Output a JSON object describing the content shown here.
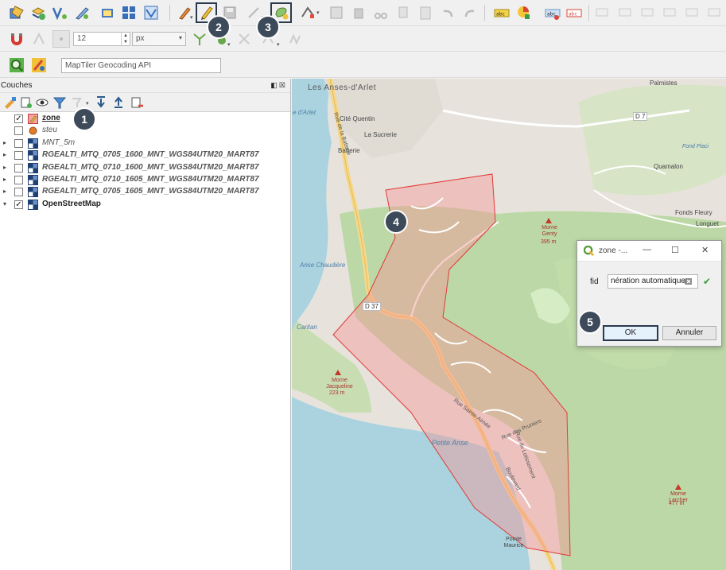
{
  "toolbar": {
    "size_value": "12",
    "unit_value": "px"
  },
  "locator": {
    "placeholder": "MapTiler Geocoding API"
  },
  "layers_panel": {
    "title": "Couches",
    "layers": [
      {
        "name": "zone",
        "checked": true,
        "style": "bold-underline",
        "icon": "polygon-edit-icon",
        "expand": ""
      },
      {
        "name": "steu",
        "checked": false,
        "style": "italic",
        "icon": "point-icon",
        "expand": ""
      },
      {
        "name": "MNT_5m",
        "checked": false,
        "style": "italic",
        "icon": "raster-icon",
        "expand": "▸"
      },
      {
        "name": "RGEALTI_MTQ_0705_1600_MNT_WGS84UTM20_MART87",
        "checked": false,
        "style": "bold-italic",
        "icon": "raster-icon",
        "expand": "▸"
      },
      {
        "name": "RGEALTI_MTQ_0710_1600_MNT_WGS84UTM20_MART87",
        "checked": false,
        "style": "bold-italic",
        "icon": "raster-icon",
        "expand": "▸"
      },
      {
        "name": "RGEALTI_MTQ_0710_1605_MNT_WGS84UTM20_MART87",
        "checked": false,
        "style": "bold-italic",
        "icon": "raster-icon",
        "expand": "▸"
      },
      {
        "name": "RGEALTI_MTQ_0705_1605_MNT_WGS84UTM20_MART87",
        "checked": false,
        "style": "bold-italic",
        "icon": "raster-icon",
        "expand": "▸"
      },
      {
        "name": "OpenStreetMap",
        "checked": true,
        "style": "bold",
        "icon": "raster-icon",
        "expand": "▾"
      }
    ]
  },
  "map": {
    "labels": {
      "town": "Les Anses-d'Arlet",
      "arlet": "e d'Arlet",
      "cite_quentin": "Cité Quentin",
      "la_sucrerie": "La Sucrerie",
      "batterie": "Batterie",
      "rue_batterie": "Rue de la Batterie",
      "palmistes": "Palmistes",
      "d7": "D 7",
      "fond_placide": "Fond Placi",
      "quamalon": "Quamalon",
      "fonds_fleury": "Fonds Fleury",
      "longuet": "Longuet",
      "morne_genty": "Morne Genty",
      "morne_genty_alt": "395 m",
      "anse_chaudiere": "Anse Chaudière",
      "d37": "D 37",
      "anse_caritan": "Caritan",
      "morne_jacqueline": "Morne Jacqueline",
      "morne_jacqueline_alt": "223 m",
      "rue_principale": "Rue Sainte-Aimée",
      "petite_anse": "Petite Anse",
      "rue_pruniers": "Rue des Pruniers",
      "rue_lotissement": "Rue du Lotissement",
      "boulevard": "Boulevard",
      "morne_larcher": "Morne Larcher",
      "morne_larcher_alt": "477 m",
      "pointe_maurice": "Pointe Maurice"
    }
  },
  "dialog": {
    "title": "zone -...",
    "field_label": "fid",
    "field_value": "nération automatique",
    "ok_label": "OK",
    "cancel_label": "Annuler"
  },
  "badges": [
    "1",
    "2",
    "3",
    "4",
    "5"
  ]
}
